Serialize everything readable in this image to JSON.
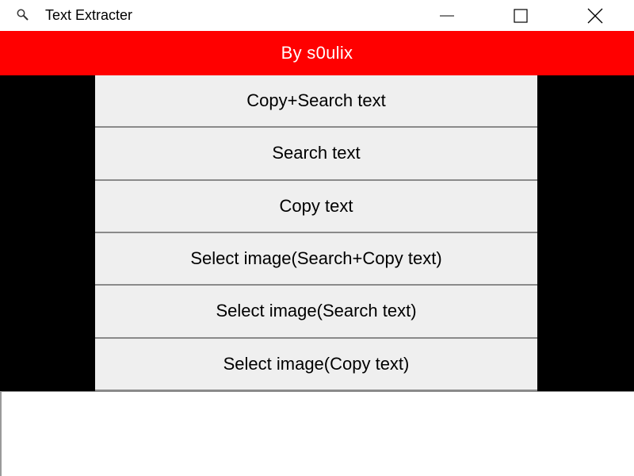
{
  "window": {
    "title": "Text Extracter",
    "icon": "magnifier-icon"
  },
  "caption_buttons": {
    "minimize": "minimize-icon",
    "maximize": "maximize-icon",
    "close": "close-icon"
  },
  "banner": {
    "text": "By s0ulix",
    "color": "#ff0000"
  },
  "actions": [
    {
      "label": "Copy+Search text"
    },
    {
      "label": "Search text"
    },
    {
      "label": "Copy text"
    },
    {
      "label": "Select image(Search+Copy text)"
    },
    {
      "label": "Select image(Search text)"
    },
    {
      "label": "Select image(Copy text)"
    }
  ]
}
